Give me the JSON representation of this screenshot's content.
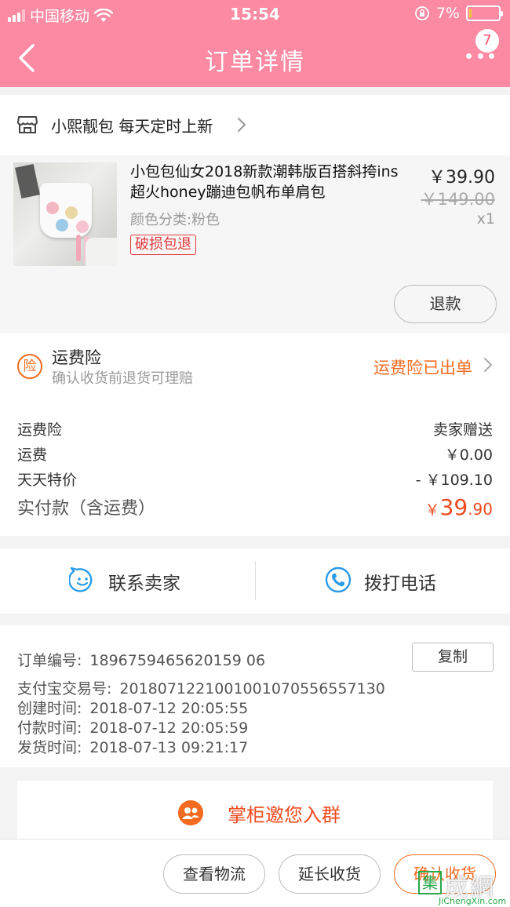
{
  "status_bar": {
    "carrier": "中国移动",
    "time": "15:54",
    "battery_percent": "7%",
    "battery_level": 0.07
  },
  "navbar": {
    "title": "订单详情",
    "badge_count": "7",
    "back_icon": "chevron-left-icon",
    "more_icon": "more-dots-icon"
  },
  "shop": {
    "name": "小熙靓包 每天定时上新",
    "icon": "store-icon"
  },
  "product": {
    "title": "小包包仙女2018新款潮韩版百搭斜挎ins超火honey蹦迪包帆布单肩包",
    "sku": "颜色分类:粉色",
    "tag": "破损包退",
    "price": "￥39.90",
    "original_price": "￥149.00",
    "quantity": "x1",
    "refund_label": "退款"
  },
  "insurance": {
    "icon_text": "险",
    "title": "运费险",
    "subtitle": "确认收货前退货可理赔",
    "status": "运费险已出单"
  },
  "fees": [
    {
      "label": "运费险",
      "value": "卖家赠送"
    },
    {
      "label": "运费",
      "value": "￥0.00"
    },
    {
      "label": "天天特价",
      "value": "- ￥109.10"
    }
  ],
  "total": {
    "label": "实付款（含运费）",
    "currency": "￥",
    "integer": "39",
    "decimal": ".90"
  },
  "contact": {
    "seller_label": "联系卖家",
    "phone_label": "拨打电话"
  },
  "order_info": {
    "order_no_label": "订单编号:",
    "order_no": "1896759465620159 06",
    "copy_label": "复制",
    "alipay_label": "支付宝交易号:",
    "alipay_no": "2018071221001001070556557130",
    "created_label": "创建时间:",
    "created": "2018-07-12 20:05:55",
    "paid_label": "付款时间:",
    "paid": "2018-07-12 20:05:59",
    "shipped_label": "发货时间:",
    "shipped": "2018-07-13 09:21:17"
  },
  "group": {
    "label": "掌柜邀您入群"
  },
  "bottom": {
    "logistics": "查看物流",
    "extend": "延长收货",
    "confirm": "确认收货"
  },
  "watermark": {
    "box_char": "集",
    "text": "成網",
    "url": "JiChengXin.com"
  },
  "colors": {
    "header": "#fb8aa2",
    "accent": "#f36b21",
    "price_red": "#f04a1f",
    "tag_red": "#e4393c"
  }
}
